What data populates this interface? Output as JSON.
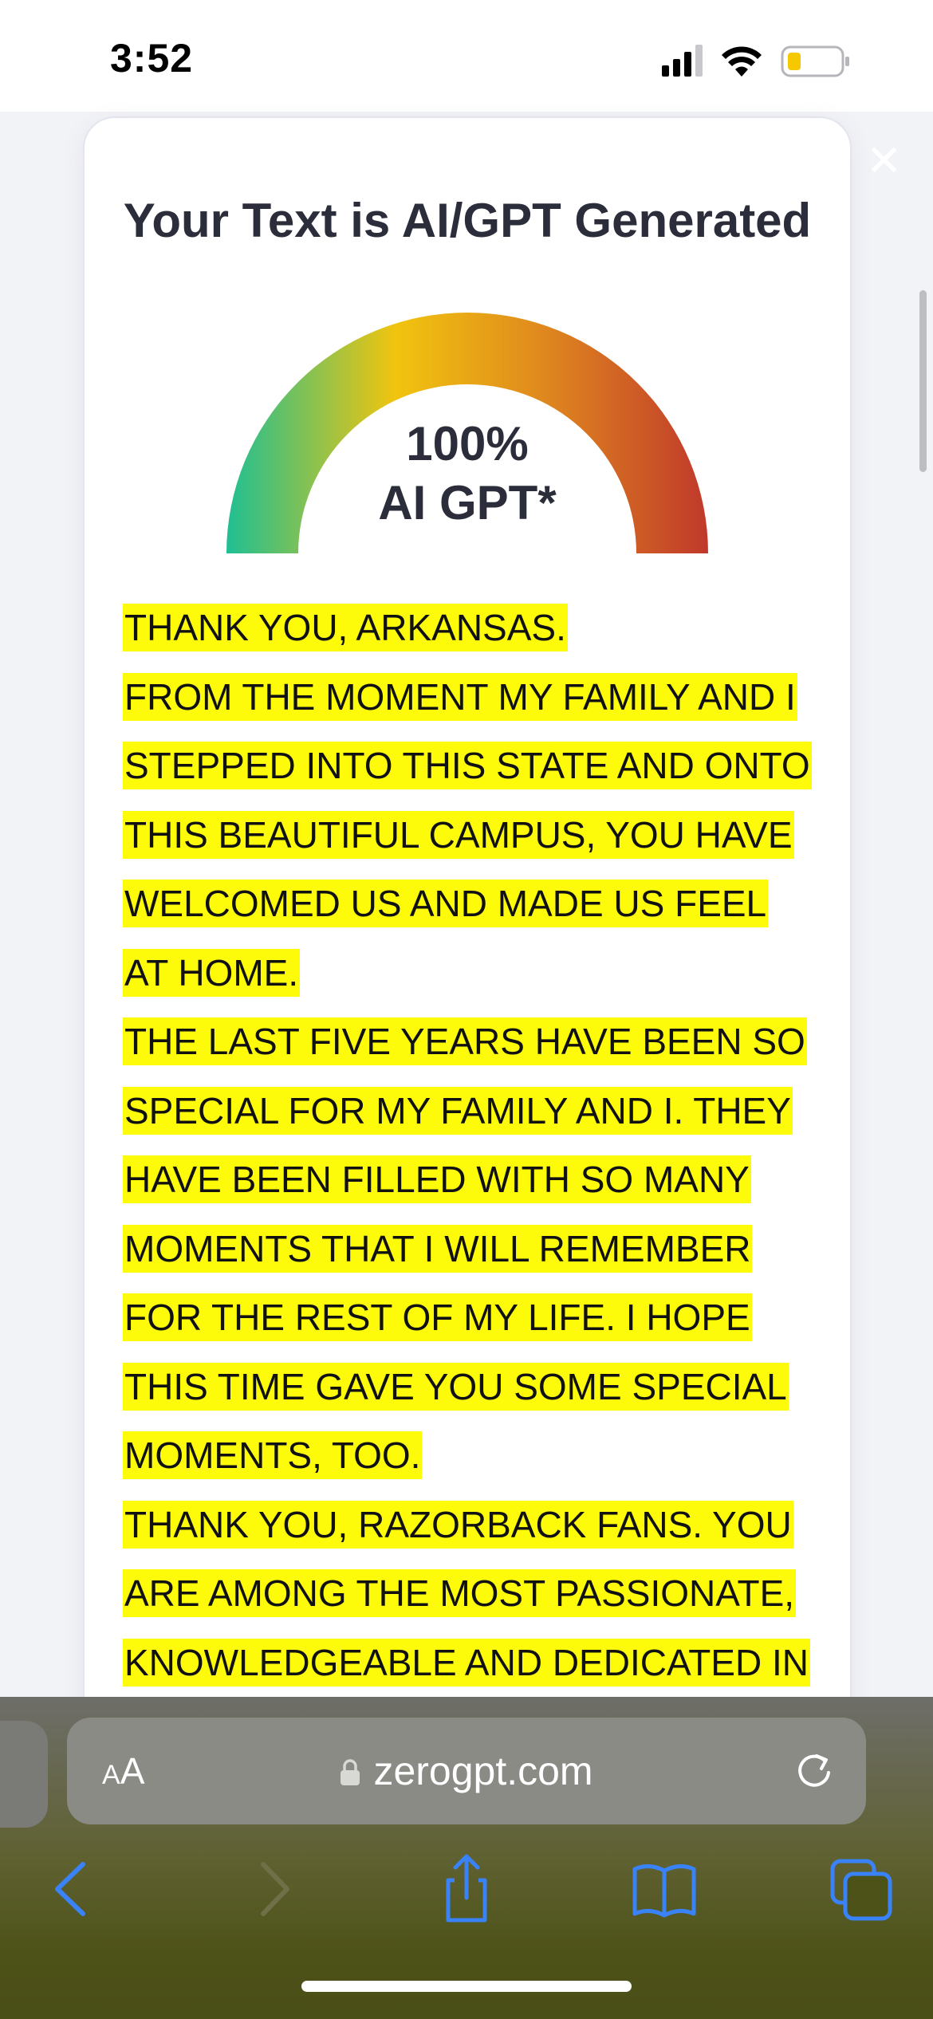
{
  "status_bar": {
    "time": "3:52"
  },
  "modal": {
    "close_symbol": "✕",
    "title": "Your Text is AI/GPT Generated",
    "gauge": {
      "percent": "100%",
      "label": "AI GPT*",
      "value": 1.0,
      "gradient_colors": [
        "#1fbf93",
        "#f1c40f",
        "#e08a1e",
        "#c0392b"
      ]
    },
    "highlight_color": "#fdfb09",
    "lines": [
      "THANK YOU, ARKANSAS.",
      "FROM THE MOMENT MY FAMILY AND I",
      "STEPPED INTO THIS STATE AND ONTO",
      "THIS BEAUTIFUL CAMPUS, YOU HAVE",
      "WELCOMED US AND MADE US FEEL",
      "AT HOME.",
      "THE LAST FIVE YEARS HAVE BEEN SO",
      "SPECIAL FOR MY FAMILY AND I. THEY",
      "HAVE BEEN FILLED WITH SO MANY",
      "MOMENTS THAT I WILL REMEMBER",
      "FOR THE REST OF MY LIFE. I HOPE",
      "THIS TIME GAVE YOU SOME SPECIAL",
      "MOMENTS, TOO.",
      "THANK YOU, RAZORBACK FANS. YOU",
      "ARE AMONG THE MOST PASSIONATE,",
      "KNOWLEDGEABLE AND DEDICATED IN"
    ]
  },
  "browser": {
    "aa_large": "A",
    "aa_small": "A",
    "url": "zerogpt.com",
    "icons": {
      "lock": "lock-icon",
      "reload": "reload-icon",
      "back": "chevron-left-icon",
      "forward": "chevron-right-icon",
      "share": "share-icon",
      "bookmarks": "book-icon",
      "tabs": "tabs-icon"
    },
    "accent_color": "#3a82f7"
  }
}
